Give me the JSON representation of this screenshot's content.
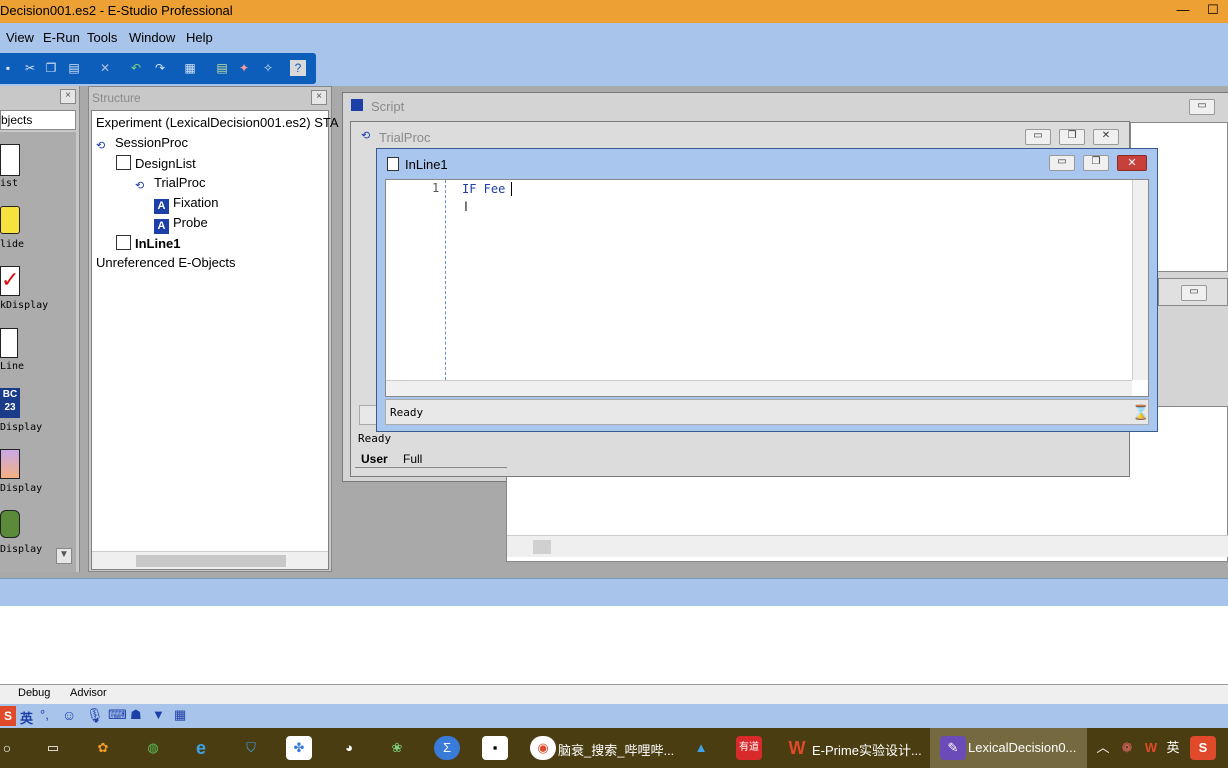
{
  "window": {
    "title": "Decision001.es2 - E-Studio Professional",
    "minimize": "—",
    "maximize": "☐"
  },
  "menu": [
    "View",
    "E-Run",
    "Tools",
    "Window",
    "Help"
  ],
  "toolbox": {
    "close": "×",
    "header": "bjects",
    "items": [
      "ist",
      "lide",
      "kDisplay",
      "Line",
      "Display",
      "Display",
      "Display"
    ],
    "scroll_down": "▼"
  },
  "structure": {
    "title": "Structure",
    "close": "×",
    "tree": [
      {
        "label": "Experiment (LexicalDecision001.es2) STA",
        "bold": false
      },
      {
        "label": "SessionProc",
        "bold": false
      },
      {
        "label": "DesignList",
        "bold": false
      },
      {
        "label": "TrialProc",
        "bold": false
      },
      {
        "label": "Fixation",
        "bold": false
      },
      {
        "label": "Probe",
        "bold": false
      },
      {
        "label": "InLine1",
        "bold": true
      },
      {
        "label": "Unreferenced E-Objects",
        "bold": false
      }
    ]
  },
  "script_window": {
    "title": "Script"
  },
  "trialproc_window": {
    "title": "TrialProc",
    "status": "Ready",
    "tabs": [
      "User",
      "Full"
    ]
  },
  "inline_window": {
    "title": "InLine1",
    "line_number": "1",
    "code": "IF Fee",
    "status": "Ready"
  },
  "output": {
    "tabs": [
      "Debug",
      "Advisor"
    ]
  },
  "ime": {
    "lang": "英"
  },
  "taskbar": {
    "apps": [
      {
        "label": "脑衰_搜索_哔哩哔..."
      },
      {
        "label": "E-Prime实验设计..."
      },
      {
        "label": "LexicalDecision0..."
      }
    ],
    "tray_lang": "英"
  },
  "colors": {
    "title_orange": "#eda034",
    "chrome_blue": "#a8c4ea",
    "toolbar_blue": "#0d5dba",
    "taskbar": "#4a3d12"
  }
}
